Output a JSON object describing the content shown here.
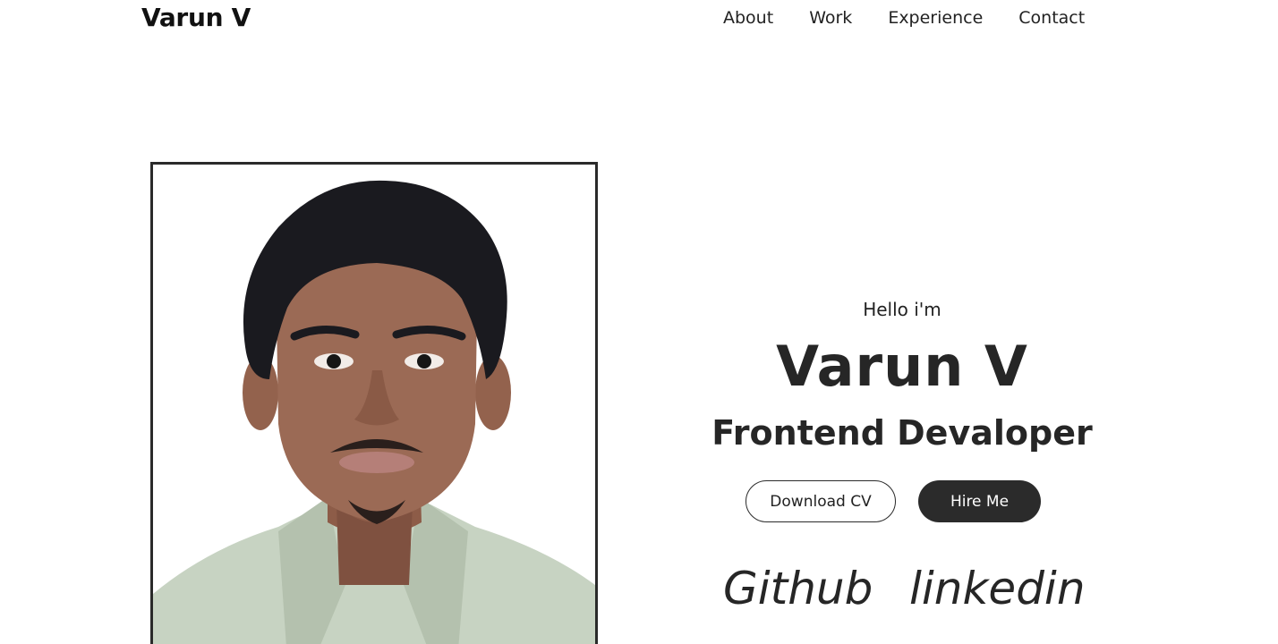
{
  "header": {
    "logo": "Varun V",
    "nav": [
      {
        "label": "About"
      },
      {
        "label": "Work"
      },
      {
        "label": "Experience"
      },
      {
        "label": "Contact"
      }
    ]
  },
  "hero": {
    "greeting": "Hello i'm",
    "name": "Varun V",
    "role": "Frontend Devaloper",
    "buttons": {
      "download_cv": "Download CV",
      "hire_me": "Hire Me"
    },
    "socials": {
      "github": "Github",
      "linkedin": "linkedin"
    }
  },
  "colors": {
    "text": "#262626",
    "button_dark": "#2b2b2b",
    "frame_border": "#2a2a2a",
    "photo_shirt": "#c7d3c2",
    "photo_hair": "#1a1a1f",
    "photo_skin": "#9b6a55"
  }
}
